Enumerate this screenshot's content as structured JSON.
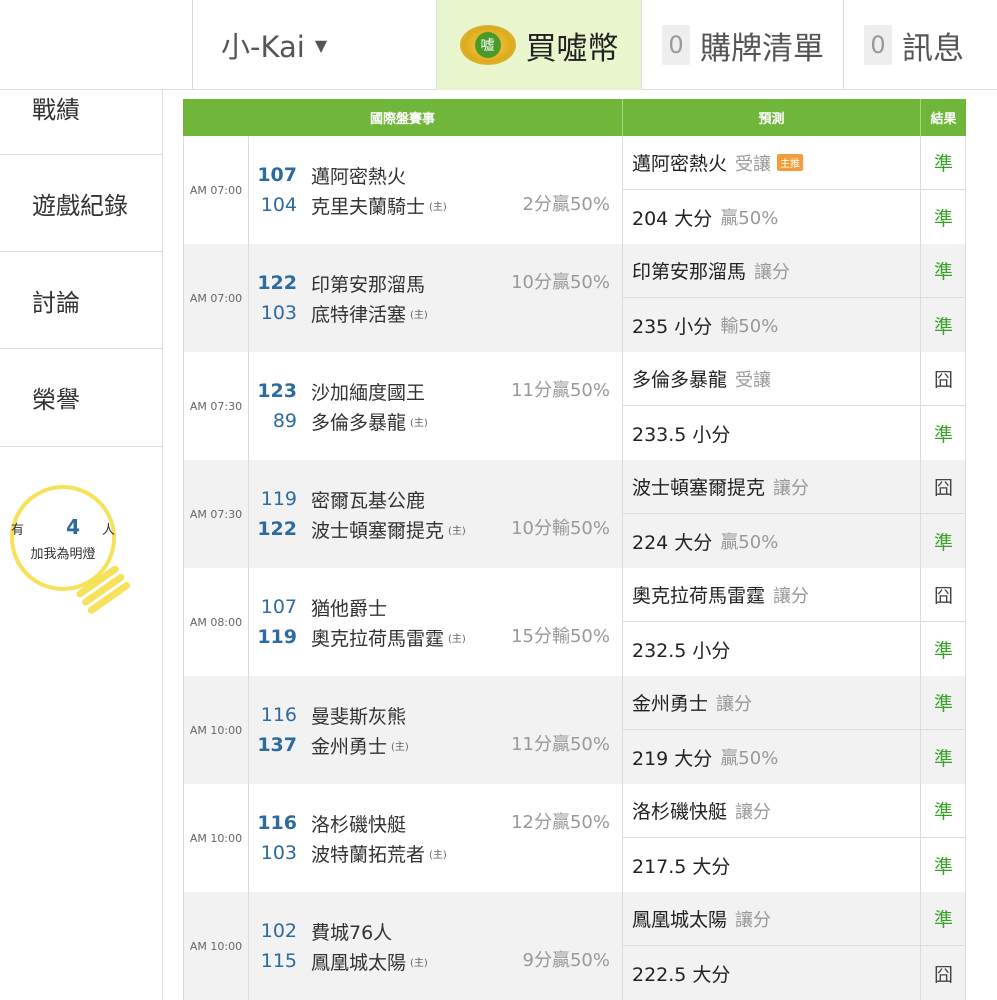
{
  "topbar": {
    "username": "小-Kai",
    "coin_icon_text": "嘘",
    "buy_coins": "買噓幣",
    "cart_count": "0",
    "cart_label": "購牌清單",
    "msg_count": "0",
    "msg_label": "訊息"
  },
  "sidebar": {
    "items": [
      {
        "label": "戰績"
      },
      {
        "label": "遊戲紀錄"
      },
      {
        "label": "討論"
      },
      {
        "label": "榮譽"
      }
    ],
    "fans": {
      "prefix": "有",
      "count": "4",
      "suffix": "人",
      "line2": "加我為明燈"
    }
  },
  "table": {
    "headers": {
      "game": "國際盤賽事",
      "prediction": "預測",
      "result": "結果"
    },
    "home_mark": "(主)",
    "rows": [
      {
        "time": "AM 07:00",
        "team1": {
          "num": "107",
          "name": "邁阿密熱火"
        },
        "team2": {
          "num": "104",
          "name": "克里夫蘭騎士"
        },
        "spread": "2分贏50%",
        "pred1": {
          "main": "邁阿密熱火",
          "suffix": "受讓",
          "tag": "主推"
        },
        "pred2": {
          "main": "204 大分",
          "suffix": "贏50%"
        },
        "res1": "準",
        "res2": "準"
      },
      {
        "time": "AM 07:00",
        "team1": {
          "num": "122",
          "name": "印第安那溜馬"
        },
        "team2": {
          "num": "103",
          "name": "底特律活塞"
        },
        "spread": "10分贏50%",
        "pred1": {
          "main": "印第安那溜馬",
          "suffix": "讓分"
        },
        "pred2": {
          "main": "235 小分",
          "suffix": "輸50%"
        },
        "res1": "準",
        "res2": "準"
      },
      {
        "time": "AM 07:30",
        "team1": {
          "num": "123",
          "name": "沙加緬度國王"
        },
        "team2": {
          "num": "89",
          "name": "多倫多暴龍"
        },
        "spread": "11分贏50%",
        "pred1": {
          "main": "多倫多暴龍",
          "suffix": "受讓"
        },
        "pred2": {
          "main": "233.5 小分",
          "suffix": ""
        },
        "res1": "囧",
        "res2": "準"
      },
      {
        "time": "AM 07:30",
        "team1": {
          "num": "119",
          "name": "密爾瓦基公鹿"
        },
        "team2": {
          "num": "122",
          "name": "波士頓塞爾提克"
        },
        "spread": "10分輸50%",
        "pred1": {
          "main": "波士頓塞爾提克",
          "suffix": "讓分"
        },
        "pred2": {
          "main": "224 大分",
          "suffix": "贏50%"
        },
        "res1": "囧",
        "res2": "準"
      },
      {
        "time": "AM 08:00",
        "team1": {
          "num": "107",
          "name": "猶他爵士"
        },
        "team2": {
          "num": "119",
          "name": "奧克拉荷馬雷霆"
        },
        "spread": "15分輸50%",
        "pred1": {
          "main": "奧克拉荷馬雷霆",
          "suffix": "讓分"
        },
        "pred2": {
          "main": "232.5 小分",
          "suffix": ""
        },
        "res1": "囧",
        "res2": "準"
      },
      {
        "time": "AM 10:00",
        "team1": {
          "num": "116",
          "name": "曼斐斯灰熊"
        },
        "team2": {
          "num": "137",
          "name": "金州勇士"
        },
        "spread": "11分贏50%",
        "pred1": {
          "main": "金州勇士",
          "suffix": "讓分"
        },
        "pred2": {
          "main": "219 大分",
          "suffix": "贏50%"
        },
        "res1": "準",
        "res2": "準"
      },
      {
        "time": "AM 10:00",
        "team1": {
          "num": "116",
          "name": "洛杉磯快艇"
        },
        "team2": {
          "num": "103",
          "name": "波特蘭拓荒者"
        },
        "spread": "12分贏50%",
        "pred1": {
          "main": "洛杉磯快艇",
          "suffix": "讓分"
        },
        "pred2": {
          "main": "217.5 大分",
          "suffix": ""
        },
        "res1": "準",
        "res2": "準"
      },
      {
        "time": "AM 10:00",
        "team1": {
          "num": "102",
          "name": "費城76人"
        },
        "team2": {
          "num": "115",
          "name": "鳳凰城太陽"
        },
        "spread": "9分贏50%",
        "pred1": {
          "main": "鳳凰城太陽",
          "suffix": "讓分"
        },
        "pred2": {
          "main": "222.5 大分",
          "suffix": ""
        },
        "res1": "準",
        "res2": "囧"
      }
    ]
  },
  "colors": {
    "header_green": "#6fb63a",
    "win_green": "#3aa12a",
    "team_num_blue": "#2d6a9f",
    "tag_orange": "#f29d39"
  }
}
